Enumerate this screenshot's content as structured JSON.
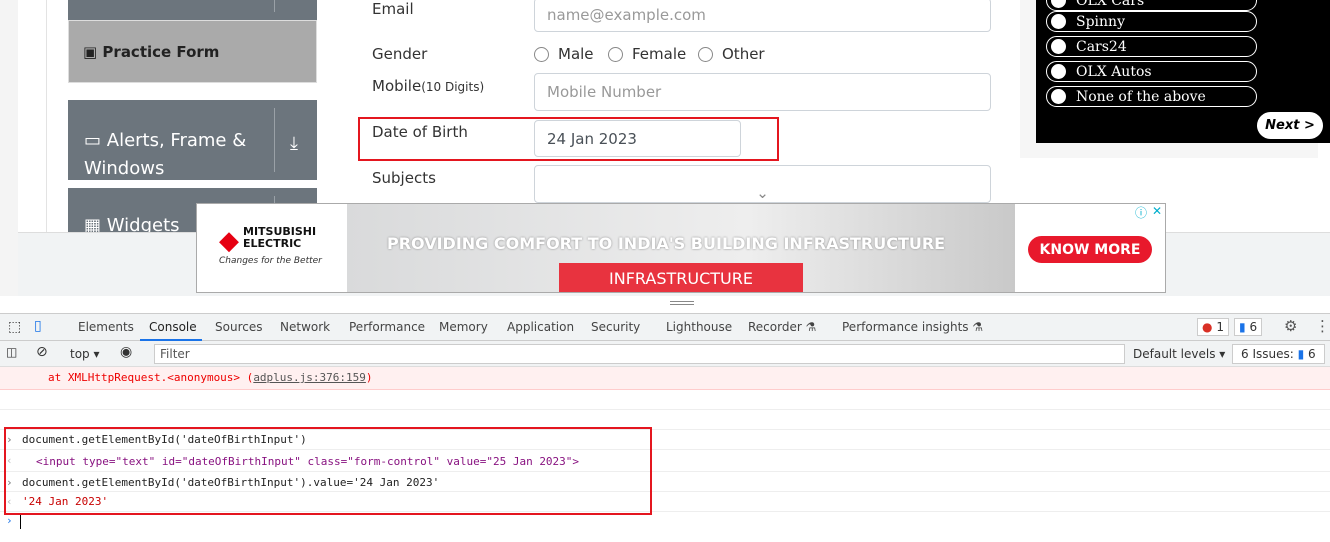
{
  "sidebar": {
    "practice_form": "Practice Form",
    "alerts": "Alerts, Frame & Windows",
    "widgets": "Widgets"
  },
  "form": {
    "email_label": "Email",
    "email_placeholder": "name@example.com",
    "gender_label": "Gender",
    "gender_options": [
      "Male",
      "Female",
      "Other"
    ],
    "mobile_label": "Mobile",
    "mobile_hint": "(10 Digits)",
    "mobile_placeholder": "Mobile Number",
    "dob_label": "Date of Birth",
    "dob_value": "24 Jan 2023",
    "subjects_label": "Subjects"
  },
  "quiz": {
    "options": [
      "OLX Cars",
      "Spinny",
      "Cars24",
      "OLX Autos",
      "None of the above"
    ],
    "next": "Next >"
  },
  "ad": {
    "brand": "MITSUBISHI ELECTRIC",
    "tagline": "Changes for the Better",
    "headline": "PROVIDING COMFORT TO INDIA'S BUILDING INFRASTRUCTURE",
    "tag": "INFRASTRUCTURE",
    "cta": "KNOW MORE"
  },
  "devtools": {
    "tabs": [
      "Elements",
      "Console",
      "Sources",
      "Network",
      "Performance",
      "Memory",
      "Application",
      "Security",
      "Lighthouse",
      "Recorder",
      "Performance insights"
    ],
    "active_tab": "Console",
    "errors": "1",
    "messages": "6",
    "context": "top",
    "filter_placeholder": "Filter",
    "levels": "Default levels",
    "issues_label": "6 Issues:",
    "issues_count": "6",
    "error_line": "at XMLHttpRequest.<anonymous> (",
    "error_link": "adplus.js:376:159",
    "error_end": ")",
    "console": [
      {
        "type": "in",
        "text": "document.getElementById('dateOfBirthInput')"
      },
      {
        "type": "out",
        "text": "<input type=\"text\" id=\"dateOfBirthInput\" class=\"form-control\" value=\"25 Jan 2023\">"
      },
      {
        "type": "in",
        "text": "document.getElementById('dateOfBirthInput').value='24 Jan 2023'"
      },
      {
        "type": "out",
        "text": "'24 Jan 2023'"
      }
    ]
  },
  "colors": {
    "highlight": "#e4161f",
    "accent": "#1a73e8",
    "sidebar": "#6c757d"
  }
}
